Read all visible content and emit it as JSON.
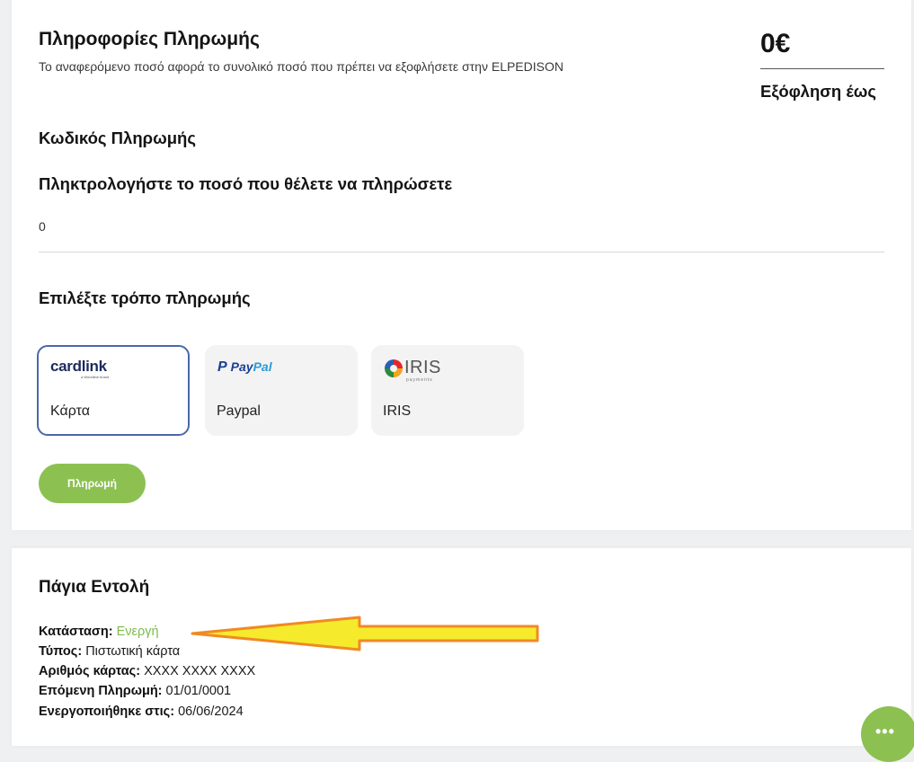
{
  "payment_info": {
    "title": "Πληροφορίες Πληρωμής",
    "subtitle": "Το αναφερόμενο ποσό αφορά το συνολικό ποσό που πρέπει να εξοφλήσετε στην ELPEDISON",
    "amount": "0€",
    "due_label": "Εξόφληση έως"
  },
  "payment_code_label": "Κωδικός Πληρωμής",
  "amount_prompt": "Πληκτρολογήστε το ποσό που θέλετε να πληρώσετε",
  "amount_value": "0",
  "method_prompt": "Επιλέξτε τρόπο πληρωμής",
  "methods": [
    {
      "label": "Κάρτα",
      "logo_text": "cardlink",
      "logo_sub": "a Worldline brand",
      "selected": true
    },
    {
      "label": "Paypal",
      "logo_pay": "Pay",
      "logo_pal": "Pal",
      "selected": false
    },
    {
      "label": "IRIS",
      "logo_text": "IRIS",
      "logo_sub": "payments",
      "selected": false
    }
  ],
  "pay_button": "Πληρωμή",
  "standing_order": {
    "title": "Πάγια Εντολή",
    "status_label": "Κατάσταση:",
    "status_value": "Ενεργή",
    "type_label": "Τύπος:",
    "type_value": "Πιστωτική κάρτα",
    "card_label": "Αριθμός κάρτας:",
    "card_value": "XXXX XXXX XXXX",
    "next_label": "Επόμενη Πληρωμή:",
    "next_value": "01/01/0001",
    "activated_label": "Ενεργοποιήθηκε στις:",
    "activated_value": "06/06/2024"
  },
  "colors": {
    "accent_green": "#8cc152",
    "status_green": "#7dbb4f",
    "selected_border": "#4a68a8",
    "annotation_arrow": "#f5ea2c"
  },
  "icons": [
    "cardlink-logo-icon",
    "paypal-logo-icon",
    "iris-logo-icon",
    "annotation-arrow-icon",
    "chat-icon"
  ]
}
